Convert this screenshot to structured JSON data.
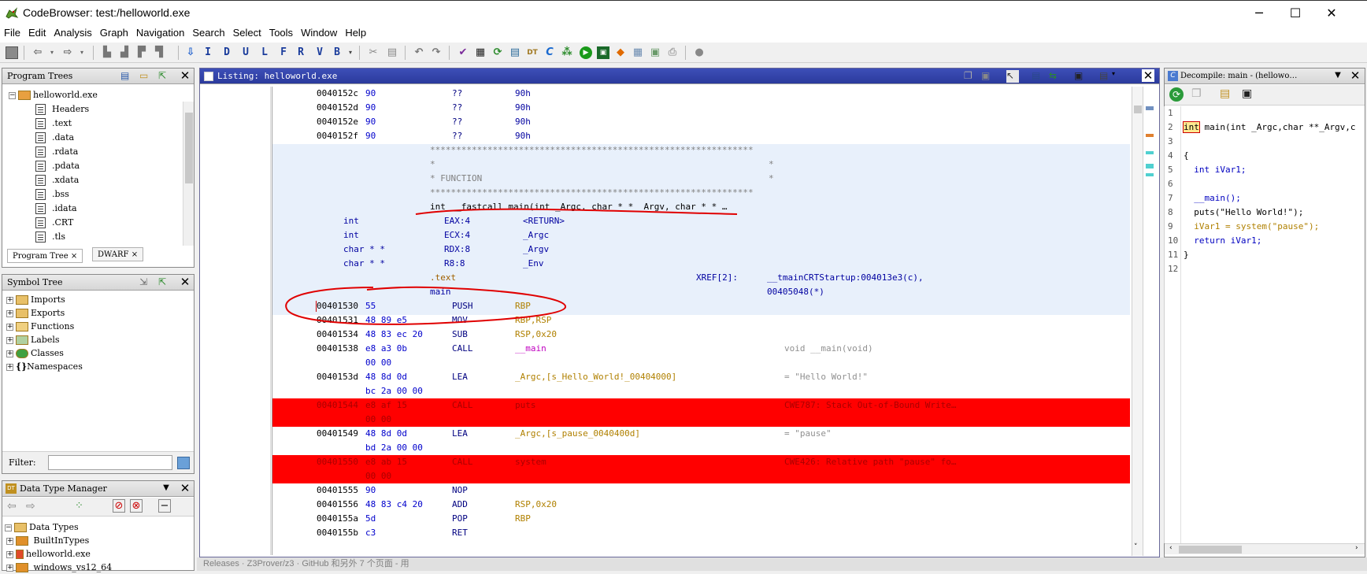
{
  "window": {
    "title": "CodeBrowser: test:/helloworld.exe",
    "minimize": "─",
    "maximize": "☐",
    "close": "✕"
  },
  "menu": [
    "File",
    "Edit",
    "Analysis",
    "Graph",
    "Navigation",
    "Search",
    "Select",
    "Tools",
    "Window",
    "Help"
  ],
  "toolbar": {
    "letters": [
      "I",
      "D",
      "U",
      "L",
      "F",
      "R",
      "V",
      "B"
    ]
  },
  "program_trees": {
    "title": "Program Trees",
    "root": "helloworld.exe",
    "items": [
      "Headers",
      ".text",
      ".data",
      ".rdata",
      ".pdata",
      ".xdata",
      ".bss",
      ".idata",
      ".CRT",
      ".tls"
    ],
    "tabs": [
      "Program Tree",
      "DWARF"
    ]
  },
  "symbol_tree": {
    "title": "Symbol Tree",
    "items": [
      "Imports",
      "Exports",
      "Functions",
      "Labels",
      "Classes",
      "Namespaces"
    ],
    "filter_label": "Filter:"
  },
  "data_type_manager": {
    "title": "Data Type Manager",
    "items": [
      "Data Types",
      "BuiltInTypes",
      "helloworld.exe",
      "windows_vs12_64"
    ]
  },
  "listing": {
    "title": "Listing:  helloworld.exe",
    "rows_top": [
      {
        "addr": "0040152c",
        "bytes": "90",
        "mnem": "??",
        "opnd": "90h"
      },
      {
        "addr": "0040152d",
        "bytes": "90",
        "mnem": "??",
        "opnd": "90h"
      },
      {
        "addr": "0040152e",
        "bytes": "90",
        "mnem": "??",
        "opnd": "90h"
      },
      {
        "addr": "0040152f",
        "bytes": "90",
        "mnem": "??",
        "opnd": "90h"
      }
    ],
    "header_stars": "**************************************************************",
    "header_star_side": "*",
    "header_function": "*  FUNCTION",
    "header_function_end": "*",
    "signature": "int __fastcall main(int _Argc, char * * _Argv, char * * …",
    "params": [
      {
        "type": "int",
        "storage": "EAX:4",
        "name": "<RETURN>"
      },
      {
        "type": "int",
        "storage": "ECX:4",
        "name": "_Argc"
      },
      {
        "type": "char * *",
        "storage": "RDX:8",
        "name": "_Argv"
      },
      {
        "type": "char * *",
        "storage": "R8:8",
        "name": "_Env"
      }
    ],
    "section": ".text",
    "xref_label": "XREF[2]:",
    "xref1": "__tmainCRTStartup:004013e3(c),",
    "xref2": "00405048(*)",
    "label_main": "main",
    "rows": [
      {
        "addr": "00401530",
        "bytes": "55",
        "mnem": "PUSH",
        "opnd": "RBP",
        "cmt": ""
      },
      {
        "addr": "00401531",
        "bytes": "48 89 e5",
        "mnem": "MOV",
        "opnd": "RBP,RSP",
        "cmt": ""
      },
      {
        "addr": "00401534",
        "bytes": "48 83 ec 20",
        "mnem": "SUB",
        "opnd": "RSP,0x20",
        "cmt": ""
      },
      {
        "addr": "00401538",
        "bytes": "e8 a3 0b",
        "mnem": "CALL",
        "opnd": "__main",
        "cmt": "void __main(void)"
      },
      {
        "addr": "",
        "bytes": "00 00",
        "mnem": "",
        "opnd": "",
        "cmt": ""
      },
      {
        "addr": "0040153d",
        "bytes": "48 8d 0d",
        "mnem": "LEA",
        "opnd": "_Argc,[s_Hello_World!_00404000]",
        "cmt": "= \"Hello World!\""
      },
      {
        "addr": "",
        "bytes": "bc 2a 00 00",
        "mnem": "",
        "opnd": "",
        "cmt": ""
      },
      {
        "addr": "00401544",
        "bytes": "e8 af 15",
        "mnem": "CALL",
        "opnd": "puts",
        "cmt": "CWE787: Stack Out-of-Bound Write…"
      },
      {
        "addr": "",
        "bytes": "00 00",
        "mnem": "",
        "opnd": "",
        "cmt": ""
      },
      {
        "addr": "00401549",
        "bytes": "48 8d 0d",
        "mnem": "LEA",
        "opnd": "_Argc,[s_pause_0040400d]",
        "cmt": "= \"pause\""
      },
      {
        "addr": "",
        "bytes": "bd 2a 00 00",
        "mnem": "",
        "opnd": "",
        "cmt": ""
      },
      {
        "addr": "00401550",
        "bytes": "e8 ab 15",
        "mnem": "CALL",
        "opnd": "system",
        "cmt": "CWE426: Relative path \"pause\" fo…"
      },
      {
        "addr": "",
        "bytes": "00 00",
        "mnem": "",
        "opnd": "",
        "cmt": ""
      },
      {
        "addr": "00401555",
        "bytes": "90",
        "mnem": "NOP",
        "opnd": "",
        "cmt": ""
      },
      {
        "addr": "00401556",
        "bytes": "48 83 c4 20",
        "mnem": "ADD",
        "opnd": "RSP,0x20",
        "cmt": ""
      },
      {
        "addr": "0040155a",
        "bytes": "5d",
        "mnem": "POP",
        "opnd": "RBP",
        "cmt": ""
      },
      {
        "addr": "0040155b",
        "bytes": "c3",
        "mnem": "RET",
        "opnd": "",
        "cmt": ""
      }
    ]
  },
  "decompile": {
    "title": "Decompile: main -  (hellowo…",
    "lines": [
      {
        "n": "1",
        "code": ""
      },
      {
        "n": "2",
        "code": "int main(int _Argc,char **_Argv,c"
      },
      {
        "n": "3",
        "code": ""
      },
      {
        "n": "4",
        "code": "{"
      },
      {
        "n": "5",
        "code": "  int iVar1;"
      },
      {
        "n": "6",
        "code": ""
      },
      {
        "n": "7",
        "code": "  __main();"
      },
      {
        "n": "8",
        "code": "  puts(\"Hello World!\");"
      },
      {
        "n": "9",
        "code": "  iVar1 = system(\"pause\");"
      },
      {
        "n": "10",
        "code": "  return iVar1;"
      },
      {
        "n": "11",
        "code": "}"
      },
      {
        "n": "12",
        "code": ""
      }
    ]
  },
  "statusbar": "Releases · Z3Prover/z3 · GitHub 和另外 7 个页面 - 用",
  "colors": {
    "highlight_red": "#ff0000",
    "function_bg": "#e8f0fb",
    "active_title": "#2b3a9c",
    "annotation_red": "#e00000"
  }
}
